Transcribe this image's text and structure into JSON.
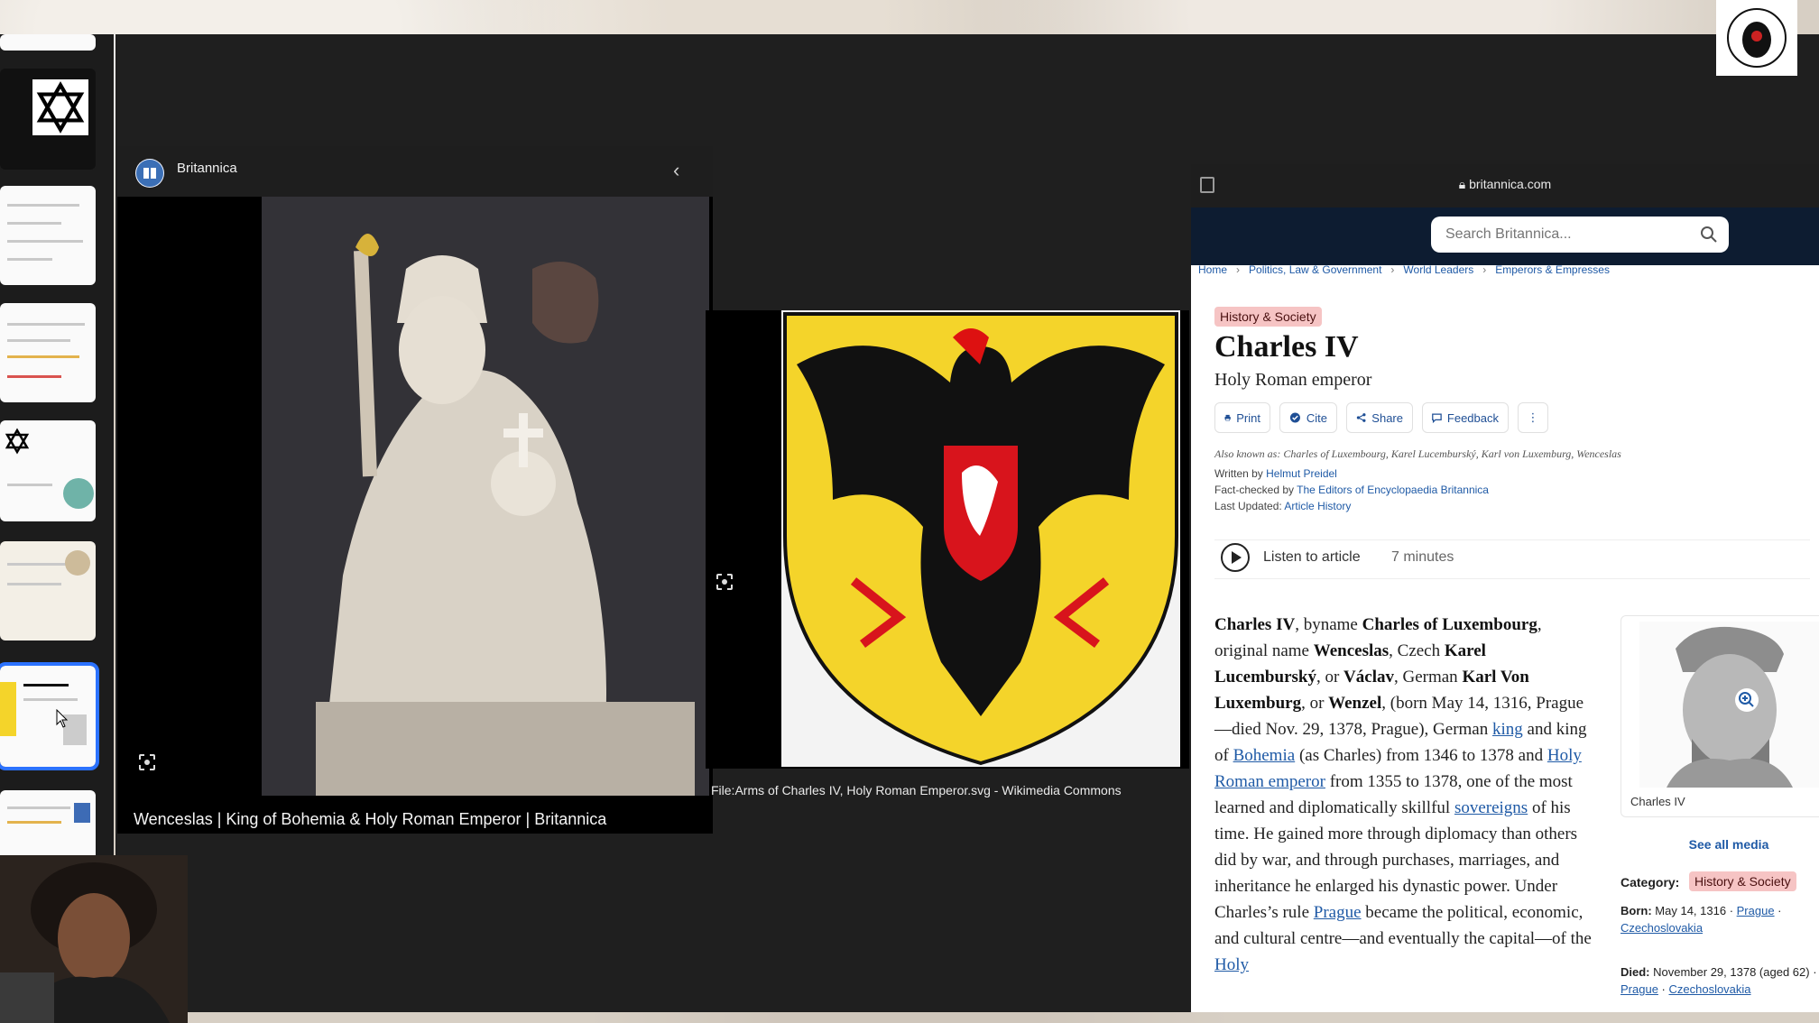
{
  "viewer": {
    "site_name": "Britannica",
    "caption": "Wenceslas | King of Bohemia & Holy Roman Emperor | Britannica"
  },
  "second_image": {
    "caption": "File:Arms of Charles IV, Holy Roman Emperor.svg - Wikimedia Commons"
  },
  "browser": {
    "url": "britannica.com",
    "search_placeholder": "Search Britannica...",
    "breadcrumbs": [
      "Home",
      "Politics, Law & Government",
      "World Leaders",
      "Emperors & Empresses"
    ],
    "category_badge": "History & Society",
    "title": "Charles IV",
    "subtitle": "Holy Roman emperor",
    "actions": {
      "print": "Print",
      "cite": "Cite",
      "share": "Share",
      "feedback": "Feedback"
    },
    "also_known_as": "Also known as: Charles of Luxembourg, Karel Lucemburský, Karl von Luxemburg, Wenceslas",
    "written_by_label": "Written by",
    "written_by": "Helmut Preidel",
    "fact_checked_label": "Fact-checked by",
    "fact_checked_by": "The Editors of Encyclopaedia Britannica",
    "last_updated_label": "Last Updated:",
    "last_updated": "Article History",
    "listen_label": "Listen to article",
    "listen_time": "7 minutes",
    "sidebar": {
      "media_caption": "Charles IV",
      "see_all": "See all media",
      "category_label": "Category:",
      "category": "History & Society",
      "born_label": "Born:",
      "born_date": "May 14, 1316",
      "born_place1": "Prague",
      "born_place2": "Czechoslovakia",
      "died_label": "Died:",
      "died_date": "November 29, 1378 (aged 62)",
      "died_place1": "Prague",
      "died_place2": "Czechoslovakia"
    }
  },
  "article": {
    "p1": "Charles IV",
    "p2": ", byname ",
    "p3": "Charles of Luxembourg",
    "p4": ", original name ",
    "p5": "Wenceslas",
    "p6": ", Czech ",
    "p7": "Karel Lucemburský",
    "p8": ", or ",
    "p9": "Václav",
    "p10": ", German ",
    "p11": "Karl Von Luxemburg",
    "p12": ", or ",
    "p13": "Wenzel",
    "p14": ", (born May 14, 1316, Prague—died Nov. 29, 1378, Prague), German ",
    "p15": "king",
    "p16": " and king of ",
    "p17": "Bohemia",
    "p18": " (as Charles) from 1346 to 1378 and ",
    "p19": "Holy Roman emperor",
    "p20": " from 1355 to 1378, one of the most learned and diplomatically skillful ",
    "p21": "sovereigns",
    "p22": " of his time. He gained more through diplomacy than others did by war, and through purchases, marriages, and inheritance he enlarged his dynastic power. Under Charles’s rule ",
    "p23": "Prague",
    "p24": " became the political, economic, and cultural centre—and eventually the capital—of the ",
    "p25": "Holy"
  },
  "colors": {
    "accent_link": "#1f5aa6",
    "nav_bg": "#0d1c31",
    "badge_bg": "#f6c4c4",
    "selection": "#2b72ff",
    "arms_yellow": "#f4d42a"
  }
}
